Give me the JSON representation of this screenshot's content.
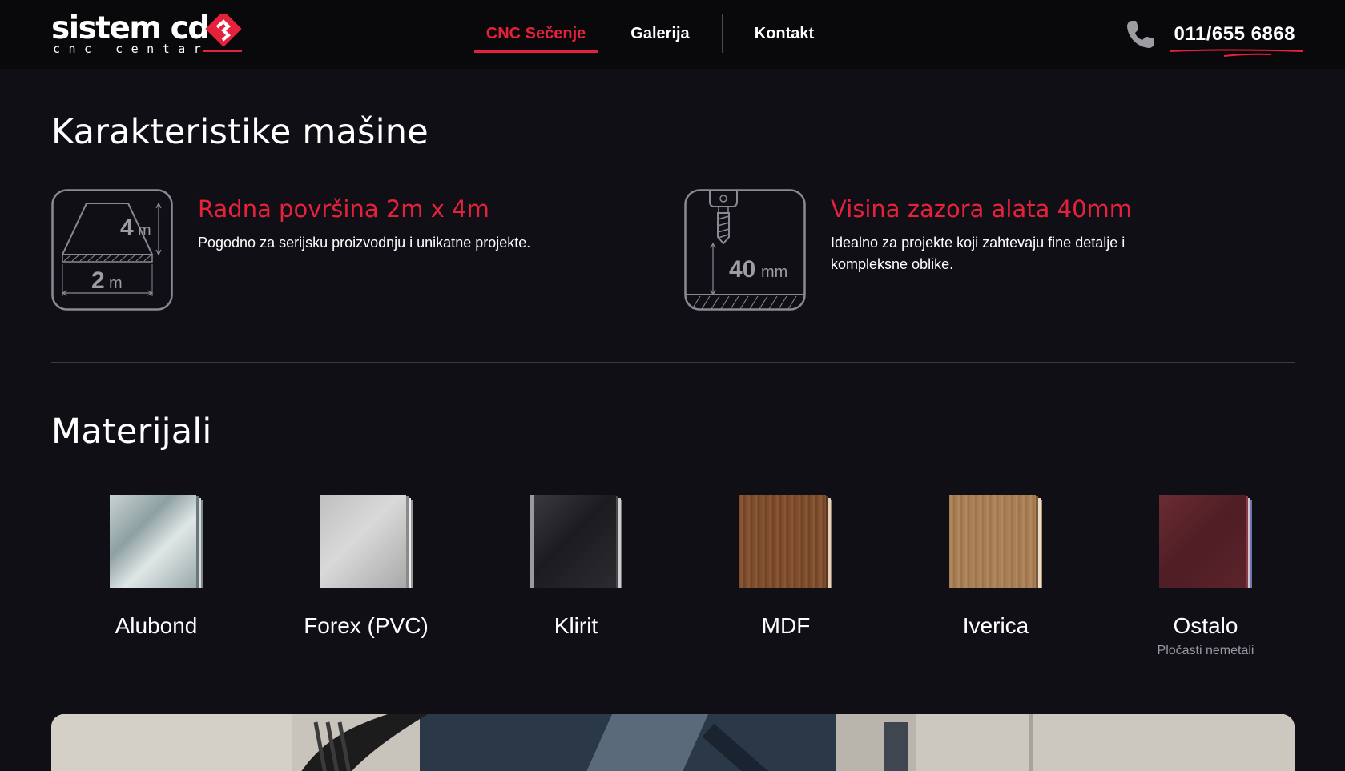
{
  "header": {
    "logo": {
      "main": "sistem cd",
      "sub": "cnc centar"
    },
    "nav": [
      {
        "label": "CNC Sečenje",
        "active": true
      },
      {
        "label": "Galerija",
        "active": false
      },
      {
        "label": "Kontakt",
        "active": false
      }
    ],
    "phone": {
      "icon": "phone-icon",
      "number": "011/655 6868"
    }
  },
  "colors": {
    "accent": "#e5213b",
    "background": "#0f0f15",
    "header": "#09090b"
  },
  "characteristics": {
    "title": "Karakteristike mašine",
    "items": [
      {
        "icon": "work-surface-icon",
        "title": "Radna površina 2m x 4m",
        "description": "Pogodno za serijsku proizvodnju i unikatne projekte.",
        "icon_labels": {
          "length_value": "4",
          "length_unit": "m",
          "width_value": "2",
          "width_unit": "m"
        }
      },
      {
        "icon": "tool-clearance-icon",
        "title": "Visina zazora alata 40mm",
        "description": "Idealno za projekte koji zahtevaju fine detalje i kompleksne oblike.",
        "icon_labels": {
          "value": "40",
          "unit": "mm"
        }
      }
    ]
  },
  "materials": {
    "title": "Materijali",
    "items": [
      {
        "label": "Alubond",
        "sub": ""
      },
      {
        "label": "Forex (PVC)",
        "sub": ""
      },
      {
        "label": "Klirit",
        "sub": ""
      },
      {
        "label": "MDF",
        "sub": ""
      },
      {
        "label": "Iverica",
        "sub": ""
      },
      {
        "label": "Ostalo",
        "sub": "Pločasti nemetali"
      }
    ]
  }
}
